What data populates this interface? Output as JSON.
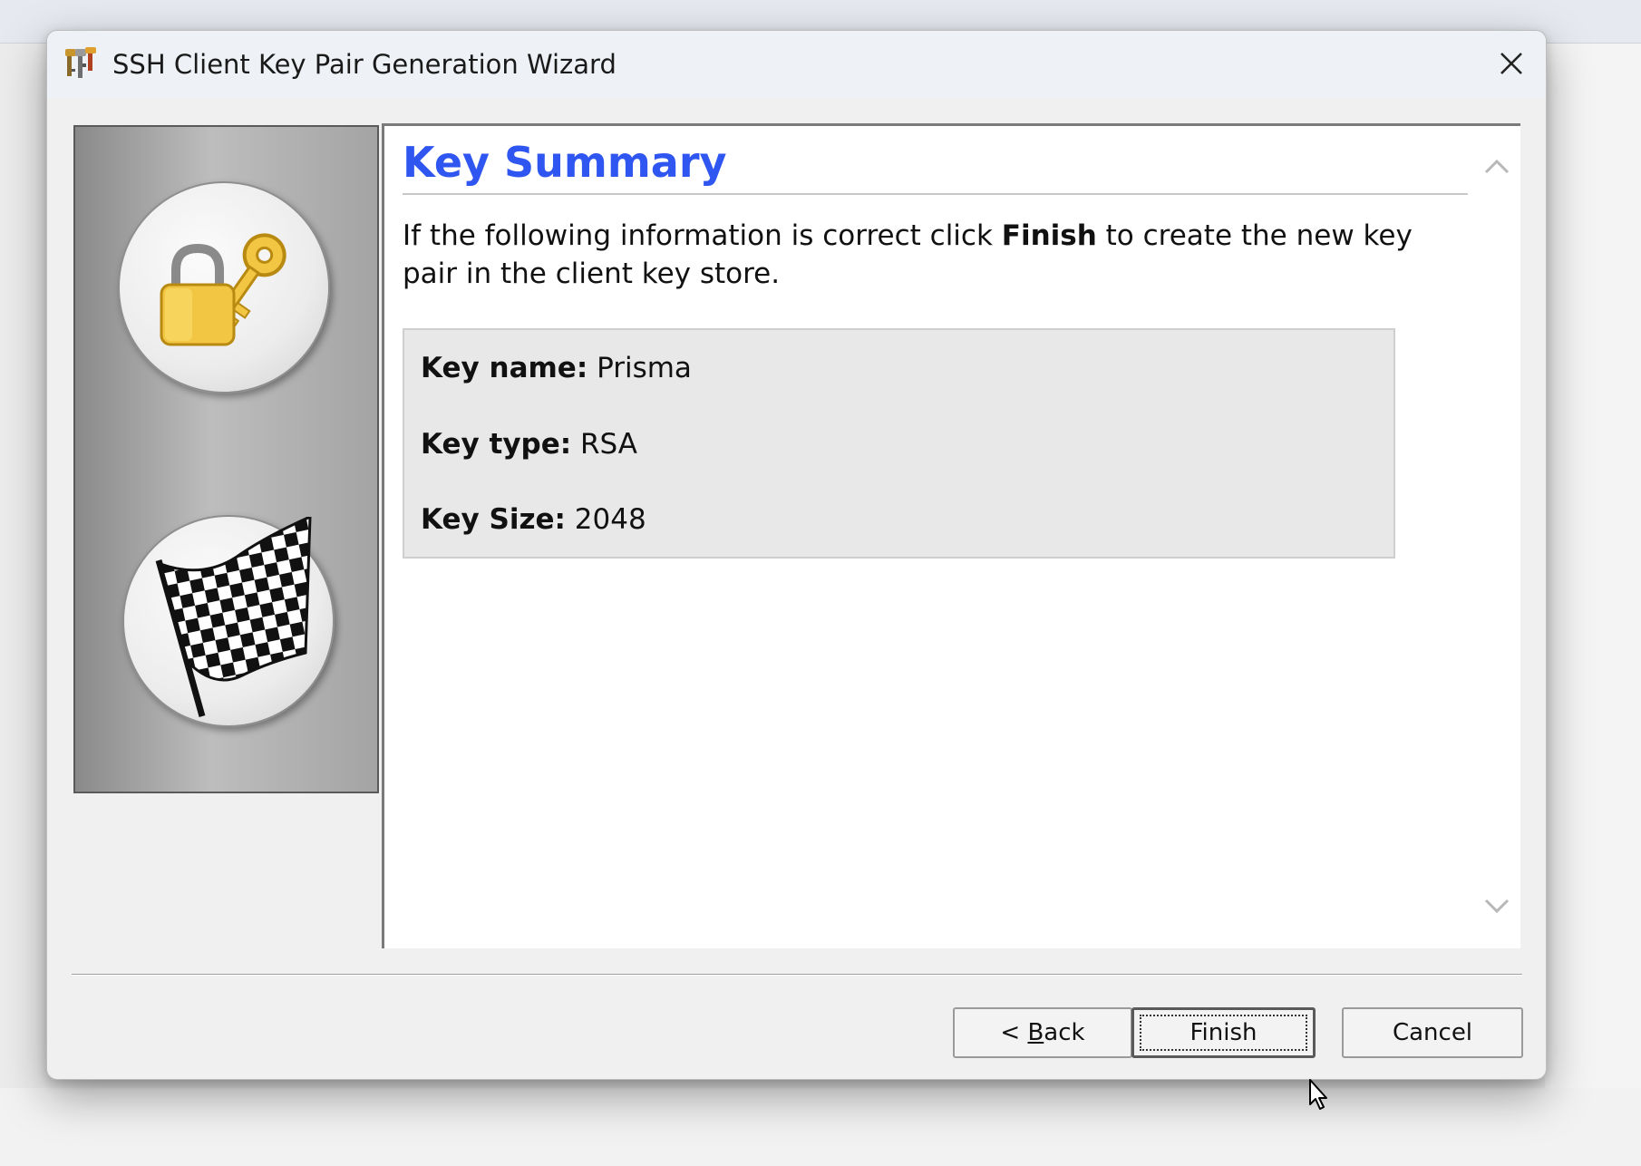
{
  "window": {
    "title": "SSH Client Key Pair Generation Wizard",
    "close_label": "×"
  },
  "page": {
    "heading": "Key Summary",
    "intro_before": "If the following information is correct click ",
    "intro_bold": "Finish",
    "intro_after": " to create the new key pair in the client key store."
  },
  "summary": {
    "key_name_label": "Key name:",
    "key_name_value": "Prisma",
    "key_type_label": "Key type:",
    "key_type_value": "RSA",
    "key_size_label": "Key Size:",
    "key_size_value": "2048"
  },
  "buttons": {
    "back_prefix": "< ",
    "back_mnemonic": "B",
    "back_rest": "ack",
    "finish": "Finish",
    "cancel": "Cancel"
  },
  "colors": {
    "heading": "#2f56f0",
    "dialog_bg": "#f0f0f0",
    "summary_bg": "#e8e8e8"
  },
  "icons": [
    "app-key-icon",
    "close-icon",
    "lock-key-icon",
    "checkered-flag-icon",
    "scroll-up-icon",
    "scroll-down-icon",
    "mouse-cursor-icon"
  ]
}
